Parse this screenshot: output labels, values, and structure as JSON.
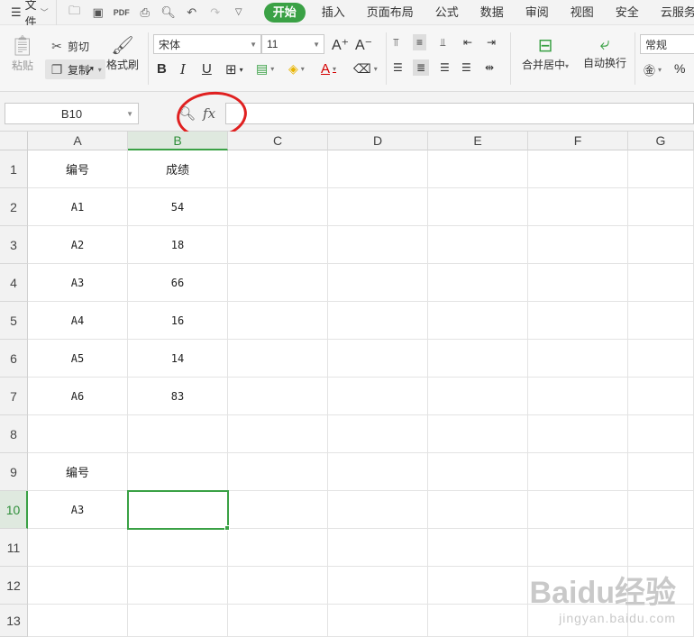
{
  "menubar": {
    "file_label": "文件",
    "tabs": [
      "开始",
      "插入",
      "页面布局",
      "公式",
      "数据",
      "审阅",
      "视图",
      "安全",
      "云服务"
    ],
    "active_tab": "开始"
  },
  "ribbon": {
    "paste_label": "粘贴",
    "cut_label": "剪切",
    "copy_label": "复制",
    "format_painter_label": "格式刷",
    "font_name": "宋体",
    "font_size": "11",
    "merge_label": "合并居中",
    "wrap_label": "自动换行",
    "number_format": "常规"
  },
  "formula_bar": {
    "name_box": "B10",
    "fx_label": "fx",
    "value": ""
  },
  "grid": {
    "columns": [
      "A",
      "B",
      "C",
      "D",
      "E",
      "F",
      "G"
    ],
    "selected_column": "B",
    "rows": [
      "1",
      "2",
      "3",
      "4",
      "5",
      "6",
      "7",
      "8",
      "9",
      "10",
      "11",
      "12",
      "13"
    ],
    "selected_row": "10",
    "cells": {
      "A1": "编号",
      "B1": "成绩",
      "A2": "A1",
      "B2": "54",
      "A3": "A2",
      "B3": "18",
      "A4": "A3",
      "B4": "66",
      "A5": "A4",
      "B5": "16",
      "A6": "A5",
      "B6": "14",
      "A7": "A6",
      "B7": "83",
      "A9": "编号",
      "A10": "A3"
    },
    "active_cell": "B10"
  },
  "watermark": {
    "brand": "Baidu经验",
    "url": "jingyan.baidu.com"
  },
  "colors": {
    "accent": "#3aa145",
    "highlight_circle": "#e02020"
  }
}
